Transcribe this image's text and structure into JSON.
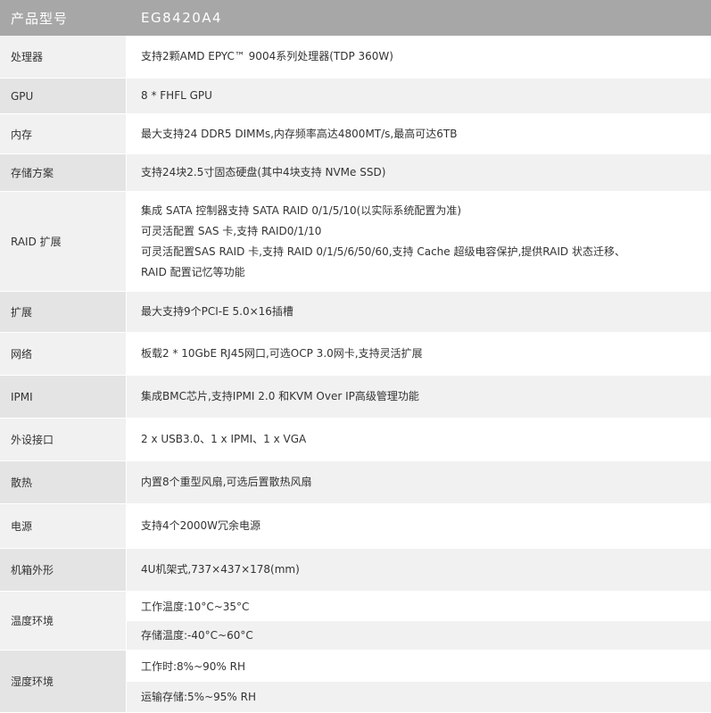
{
  "header": {
    "label": "产品型号",
    "value": "EG8420A4"
  },
  "rows": [
    {
      "label": "处理器",
      "lines": [
        "支持2颗AMD EPYC™ 9004系列处理器(TDP 360W)"
      ]
    },
    {
      "label": "GPU",
      "lines": [
        "8 * FHFL GPU"
      ]
    },
    {
      "label": "内存",
      "lines": [
        "最大支持24 DDR5 DIMMs,内存频率高达4800MT/s,最高可达6TB"
      ]
    },
    {
      "label": "存储方案",
      "lines": [
        "支持24块2.5寸固态硬盘(其中4块支持 NVMe SSD)"
      ]
    },
    {
      "label": "RAID 扩展",
      "lines": [
        "集成 SATA 控制器支持 SATA RAID 0/1/5/10(以实际系统配置为准)",
        "可灵活配置 SAS 卡,支持 RAID0/1/10",
        "可灵活配置SAS RAID 卡,支持 RAID 0/1/5/6/50/60,支持 Cache 超级电容保护,提供RAID 状态迁移、",
        "RAID 配置记忆等功能"
      ]
    },
    {
      "label": "扩展",
      "lines": [
        "最大支持9个PCI-E 5.0×16插槽"
      ]
    },
    {
      "label": "网络",
      "lines": [
        "板载2 * 10GbE RJ45网口,可选OCP 3.0网卡,支持灵活扩展"
      ]
    },
    {
      "label": "IPMI",
      "lines": [
        "集成BMC芯片,支持IPMI 2.0 和KVM Over IP高级管理功能"
      ]
    },
    {
      "label": "外设接口",
      "lines": [
        "2 x USB3.0、1 x IPMI、1 x VGA"
      ]
    },
    {
      "label": "散热",
      "lines": [
        "内置8个重型风扇,可选后置散热风扇"
      ]
    },
    {
      "label": "电源",
      "lines": [
        "支持4个2000W冗余电源"
      ]
    },
    {
      "label": "机箱外形",
      "lines": [
        "4U机架式,737×437×178(mm)"
      ]
    },
    {
      "label": "温度环境",
      "subs": [
        "工作温度:10°C~35°C",
        "存储温度:-40°C~60°C"
      ]
    },
    {
      "label": "湿度环境",
      "subs": [
        "工作时:8%~90% RH",
        "运输存储:5%~95% RH"
      ]
    }
  ]
}
